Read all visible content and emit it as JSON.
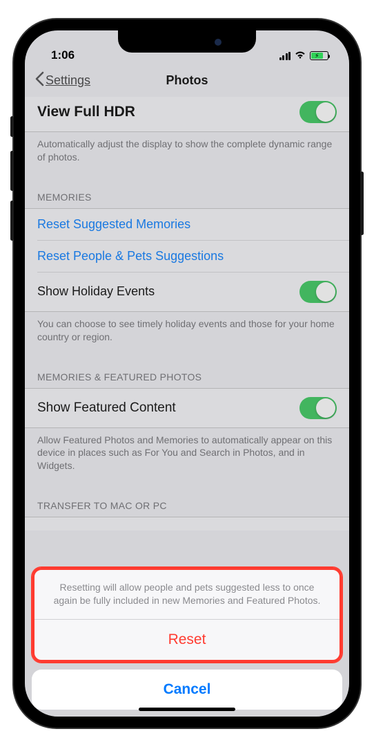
{
  "status": {
    "time": "1:06"
  },
  "nav": {
    "back_label": "Settings",
    "title": "Photos"
  },
  "hdr": {
    "label": "View Full HDR",
    "footer": "Automatically adjust the display to show the complete dynamic range of photos."
  },
  "memories": {
    "header": "MEMORIES",
    "reset_suggested": "Reset Suggested Memories",
    "reset_people": "Reset People & Pets Suggestions",
    "holiday_label": "Show Holiday Events",
    "holiday_footer": "You can choose to see timely holiday events and those for your home country or region."
  },
  "featured": {
    "header": "MEMORIES & FEATURED PHOTOS",
    "label": "Show Featured Content",
    "footer": "Allow Featured Photos and Memories to automatically appear on this device in places such as For You and Search in Photos, and in Widgets."
  },
  "transfer": {
    "header": "TRANSFER TO MAC OR PC"
  },
  "sheet": {
    "message": "Resetting will allow people and pets suggested less to once again be fully included in new Memories and Featured Photos.",
    "reset": "Reset",
    "cancel": "Cancel"
  }
}
